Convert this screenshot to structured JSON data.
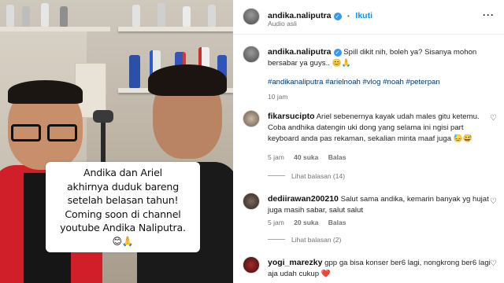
{
  "video": {
    "caption_lines": [
      "Andika dan Ariel",
      "akhirnya duduk bareng",
      "setelah belasan tahun!",
      "Coming soon di channel",
      "youtube Andika Naliputra."
    ],
    "caption_emoji": "😊🙏"
  },
  "header": {
    "username": "andika.naliputra",
    "separator": "•",
    "follow_label": "Ikuti",
    "subtitle": "Audio asli",
    "more": "···"
  },
  "post": {
    "username": "andika.naliputra",
    "text": "Spill dikit nih, boleh ya? Sisanya mohon bersabar ya guys.. 😊🙏",
    "hashtags": "#andikanaliputra #arielnoah #vlog #noah #peterpan",
    "time": "10 jam"
  },
  "comments": [
    {
      "username": "fikarsucipto",
      "text": "Ariel sebenernya kayak udah males gitu ketemu. Coba andhika datengin uki dong yang selama ini ngisi part keyboard anda pas rekaman, sekalian minta maaf juga 😓😅",
      "time": "5 jam",
      "likes": "40 suka",
      "reply_label": "Balas",
      "replies": "Lihat balasan (14)"
    },
    {
      "username": "dediirawan200210",
      "text": "Salut sama andika, kemarin banyak yg hujat juga masih sabar, salut salut",
      "time": "5 jam",
      "likes": "20 suka",
      "reply_label": "Balas",
      "replies": "Lihat balasan (2)"
    },
    {
      "username": "yogi_marezky",
      "text": "gpp ga bisa konser ber6 lagi, nongkrong ber6 lagi aja udah cukup ❤️"
    }
  ],
  "colors": {
    "accent": "#0095f6",
    "hashtag": "#00376b",
    "verified": "#3897f0",
    "muted": "#737373"
  }
}
